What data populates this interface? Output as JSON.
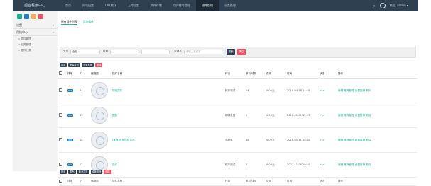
{
  "app": {
    "brand": "后台程序中心"
  },
  "topnav": {
    "items": [
      "首页",
      "网站配置",
      "URL美化",
      "上传设置",
      "文件存储",
      "用户操作管理",
      "插件管理",
      "分类管理"
    ],
    "active_index": 6
  },
  "topright": {
    "refresh_icon": "refresh-icon",
    "user": "欢迎, admin ▾"
  },
  "colors": {
    "topbar": "#2f4050",
    "accent": "#1ab394",
    "danger": "#ed5565",
    "quick": [
      "#1ab394",
      "#1c84c6",
      "#f8ac59",
      "#ed5565"
    ]
  },
  "sidebar": {
    "items": [
      {
        "label": "设置",
        "arrow": "›"
      },
      {
        "label": "用插中心",
        "arrow": "›"
      }
    ],
    "subitems": [
      "» 插件管理",
      "» 分类管理",
      "» 插件分类"
    ]
  },
  "tabs": {
    "list": "所有插件列表",
    "add": "添加插件"
  },
  "filter": {
    "category_label": "分类",
    "category_value": "全部",
    "keyword_label": "时间",
    "search_label": "关键字",
    "search_placeholder": "请输入关键字",
    "search_button": "搜索",
    "clear_button": "清空"
  },
  "actions": [
    "排序",
    "批量发布",
    "设置推荐"
  ],
  "actions_delete": "删除",
  "bottom_actions": [
    "排序",
    "发布",
    "取消发布",
    "设置推荐"
  ],
  "bottom_delete": "删除",
  "table": {
    "headers": [
      "",
      "排序",
      "ID",
      "缩略图",
      "插件名称",
      "",
      "作者",
      "参与人数",
      "费用",
      "时间",
      "状态",
      "操作"
    ],
    "rows": [
      {
        "sort": "900",
        "id": "24",
        "title": "搜索插件",
        "author": "程序测试",
        "count": "24",
        "price": "0.00元",
        "date": "2018-04-18 14:18",
        "status": "✔ ✔",
        "ops": "编辑 推荐管理 设置推荐 删除"
      },
      {
        "sort": "900",
        "id": "23",
        "title": "图集",
        "author": "建模设置",
        "count": "0",
        "price": "0.00元",
        "date": "2018-05-01 12:17",
        "status": "✔ ✔",
        "ops": "编辑 推荐管理 设置推荐 删除"
      },
      {
        "sort": "900",
        "id": "18",
        "title": "[推荐]优化插件多选",
        "author": "小程序",
        "count": "38",
        "price": "0.00元",
        "date": "2018-05-11 18:30",
        "status": "✔ ✔",
        "ops": "编辑 推荐管理 设置推荐 删除"
      },
      {
        "sort": "900",
        "id": "12",
        "title": "插件",
        "author": "程序测试",
        "count": "0",
        "price": "0.00元",
        "date": "2023-11-06 20:10",
        "status": "✔ ✔",
        "ops": "编辑 推荐管理 设置推荐 删除"
      }
    ]
  }
}
